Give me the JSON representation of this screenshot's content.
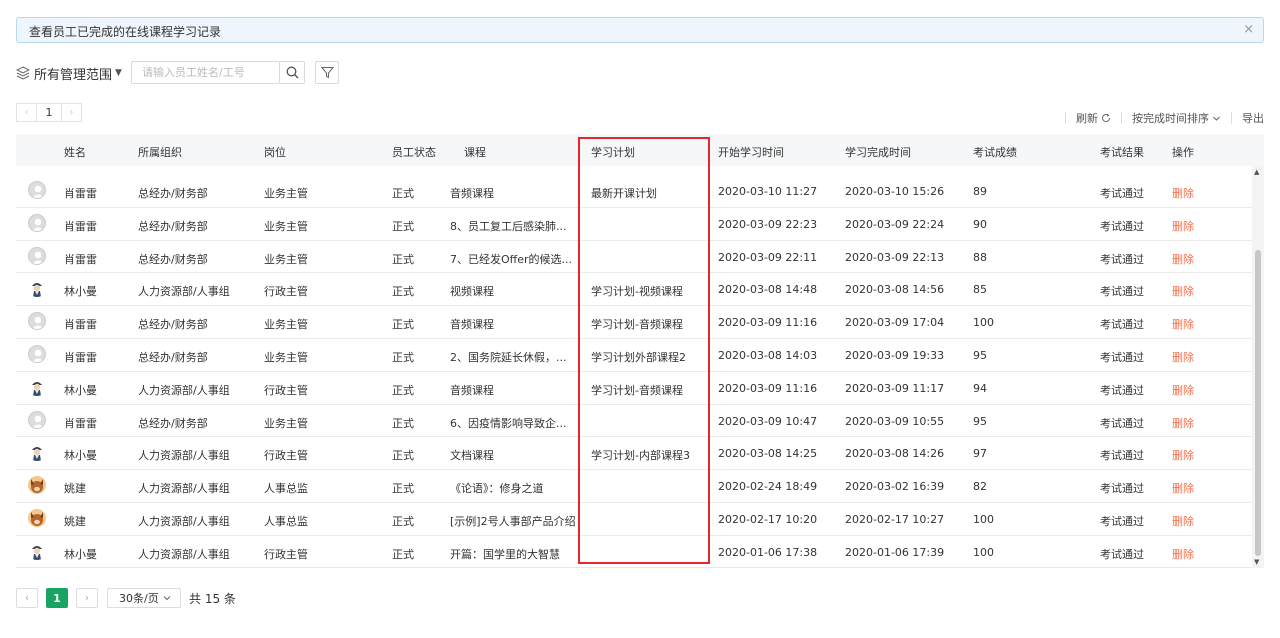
{
  "alert": {
    "text": "查看员工已完成的在线课程学习记录",
    "close": "×"
  },
  "scope": {
    "label": "所有管理范围"
  },
  "search": {
    "placeholder": "请输入员工姓名/工号"
  },
  "mini_pager": {
    "page": "1"
  },
  "actions": {
    "refresh": "刷新",
    "sort": "按完成时间排序",
    "export": "导出"
  },
  "columns": [
    "姓名",
    "所属组织",
    "岗位",
    "员工状态",
    "课程",
    "学习计划",
    "开始学习时间",
    "学习完成时间",
    "考试成绩",
    "考试结果",
    "操作"
  ],
  "rows": [
    {
      "avatar": "gray",
      "name": "肖雷雷",
      "org": "总经办/财务部",
      "post": "业务主管",
      "status": "正式",
      "course": "音频课程",
      "plan": "最新开课计划",
      "start": "2020-03-10 11:27",
      "end": "2020-03-10 15:26",
      "score": "89",
      "result": "考试通过",
      "op": "删除"
    },
    {
      "avatar": "gray",
      "name": "肖雷雷",
      "org": "总经办/财务部",
      "post": "业务主管",
      "status": "正式",
      "course": "8、员工复工后感染肺...",
      "plan": "",
      "start": "2020-03-09 22:23",
      "end": "2020-03-09 22:24",
      "score": "90",
      "result": "考试通过",
      "op": "删除"
    },
    {
      "avatar": "gray",
      "name": "肖雷雷",
      "org": "总经办/财务部",
      "post": "业务主管",
      "status": "正式",
      "course": "7、已经发Offer的候选...",
      "plan": "",
      "start": "2020-03-09 22:11",
      "end": "2020-03-09 22:13",
      "score": "88",
      "result": "考试通过",
      "op": "删除"
    },
    {
      "avatar": "cartoon",
      "name": "林小曼",
      "org": "人力资源部/人事组",
      "post": "行政主管",
      "status": "正式",
      "course": "视频课程",
      "plan": "学习计划-视频课程",
      "start": "2020-03-08 14:48",
      "end": "2020-03-08 14:56",
      "score": "85",
      "result": "考试通过",
      "op": "删除"
    },
    {
      "avatar": "gray",
      "name": "肖雷雷",
      "org": "总经办/财务部",
      "post": "业务主管",
      "status": "正式",
      "course": "音频课程",
      "plan": "学习计划-音频课程",
      "start": "2020-03-09 11:16",
      "end": "2020-03-09 17:04",
      "score": "100",
      "result": "考试通过",
      "op": "删除"
    },
    {
      "avatar": "gray",
      "name": "肖雷雷",
      "org": "总经办/财务部",
      "post": "业务主管",
      "status": "正式",
      "course": "2、国务院延长休假，...",
      "plan": "学习计划外部课程2",
      "start": "2020-03-08 14:03",
      "end": "2020-03-09 19:33",
      "score": "95",
      "result": "考试通过",
      "op": "删除"
    },
    {
      "avatar": "cartoon",
      "name": "林小曼",
      "org": "人力资源部/人事组",
      "post": "行政主管",
      "status": "正式",
      "course": "音频课程",
      "plan": "学习计划-音频课程",
      "start": "2020-03-09 11:16",
      "end": "2020-03-09 11:17",
      "score": "94",
      "result": "考试通过",
      "op": "删除"
    },
    {
      "avatar": "gray",
      "name": "肖雷雷",
      "org": "总经办/财务部",
      "post": "业务主管",
      "status": "正式",
      "course": "6、因疫情影响导致企...",
      "plan": "",
      "start": "2020-03-09 10:47",
      "end": "2020-03-09 10:55",
      "score": "95",
      "result": "考试通过",
      "op": "删除"
    },
    {
      "avatar": "cartoon",
      "name": "林小曼",
      "org": "人力资源部/人事组",
      "post": "行政主管",
      "status": "正式",
      "course": "文档课程",
      "plan": "学习计划-内部课程3",
      "start": "2020-03-08 14:25",
      "end": "2020-03-08 14:26",
      "score": "97",
      "result": "考试通过",
      "op": "删除"
    },
    {
      "avatar": "dog",
      "name": "姚建",
      "org": "人力资源部/人事组",
      "post": "人事总监",
      "status": "正式",
      "course": "《论语》：修身之道",
      "plan": "",
      "start": "2020-02-24 18:49",
      "end": "2020-03-02 16:39",
      "score": "82",
      "result": "考试通过",
      "op": "删除"
    },
    {
      "avatar": "dog",
      "name": "姚建",
      "org": "人力资源部/人事组",
      "post": "人事总监",
      "status": "正式",
      "course": "[示例]2号人事部产品介绍",
      "plan": "",
      "start": "2020-02-17 10:20",
      "end": "2020-02-17 10:27",
      "score": "100",
      "result": "考试通过",
      "op": "删除"
    },
    {
      "avatar": "cartoon",
      "name": "林小曼",
      "org": "人力资源部/人事组",
      "post": "行政主管",
      "status": "正式",
      "course": "开篇：国学里的大智慧",
      "plan": "",
      "start": "2020-01-06 17:38",
      "end": "2020-01-06 17:39",
      "score": "100",
      "result": "考试通过",
      "op": "删除"
    }
  ],
  "pager": {
    "current": "1",
    "page_size": "30条/页",
    "total": "共 15 条"
  },
  "colors": {
    "accent": "#19a463",
    "danger": "#f26f4c",
    "highlight": "#e8262b"
  },
  "icons": [
    "layers-icon",
    "search-icon",
    "filter-icon",
    "refresh-icon",
    "chevron-down-icon"
  ]
}
